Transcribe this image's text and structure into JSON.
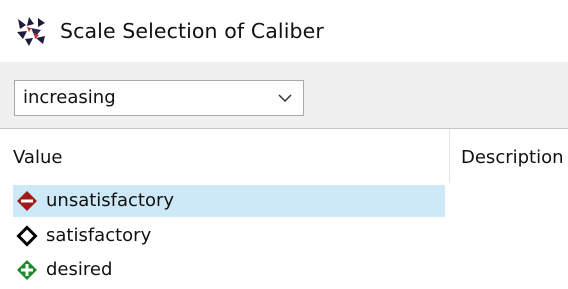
{
  "window": {
    "title": "Scale Selection of Caliber",
    "icon": "caliber-scale-icon"
  },
  "toolbar": {
    "order_dropdown": {
      "value": "increasing",
      "icon": "chevron-down-icon"
    }
  },
  "table": {
    "columns": [
      "Value",
      "Description"
    ],
    "rows": [
      {
        "label": "unsatisfactory",
        "icon": "diamond-minus-icon",
        "color": "#a01a1a",
        "selected": true
      },
      {
        "label": "satisfactory",
        "icon": "diamond-outline-icon",
        "color": "#000000",
        "selected": false
      },
      {
        "label": "desired",
        "icon": "diamond-plus-icon",
        "color": "#1f8a2c",
        "selected": false
      }
    ]
  },
  "colors": {
    "selection": "#cde8f7",
    "toolbar_bg": "#f0f0f0",
    "divider": "#c7c7c7"
  }
}
